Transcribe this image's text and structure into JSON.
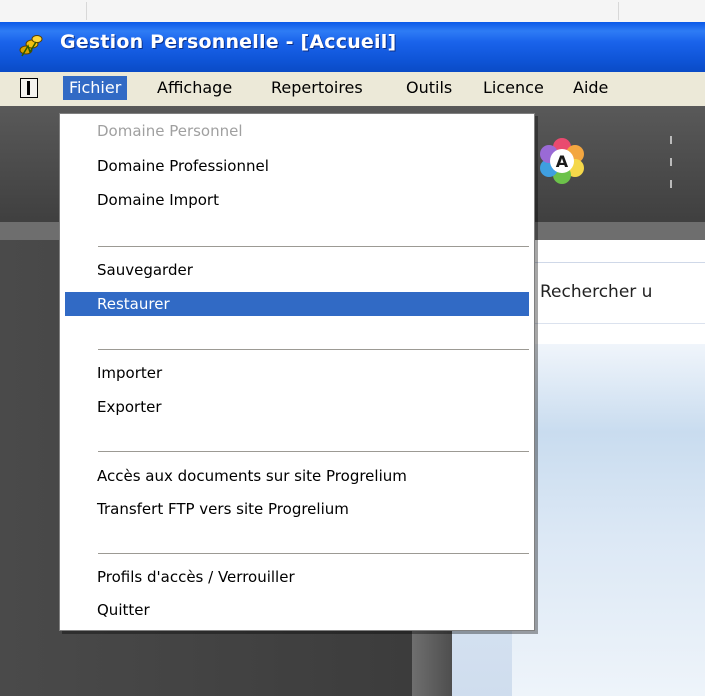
{
  "window": {
    "title": "Gestion Personnelle - [Accueil]"
  },
  "menubar": {
    "items": [
      "Fichier",
      "Affichage",
      "Repertoires",
      "Outils",
      "Licence",
      "Aide"
    ],
    "active": "Fichier"
  },
  "file_menu": {
    "items": [
      {
        "label": "Domaine Personnel",
        "state": "disabled"
      },
      {
        "label": "Domaine Professionnel",
        "state": "normal"
      },
      {
        "label": "Domaine Import",
        "state": "normal"
      },
      {
        "label": "Sauvegarder",
        "state": "normal"
      },
      {
        "label": "Restaurer",
        "state": "selected"
      },
      {
        "label": "Importer",
        "state": "normal"
      },
      {
        "label": "Exporter",
        "state": "normal"
      },
      {
        "label": "Accès aux documents sur site Progrelium",
        "state": "normal"
      },
      {
        "label": "Transfert FTP vers site Progrelium",
        "state": "normal"
      },
      {
        "label": "Profils d'accès / Verrouiller",
        "state": "normal"
      },
      {
        "label": "Quitter",
        "state": "normal"
      }
    ]
  },
  "search": {
    "label": "Rechercher u"
  },
  "icons": {
    "app": "coins-icon",
    "system_menu": "system-menu-icon",
    "toolbar_logo": "flower-a-logo-icon"
  },
  "colors": {
    "titlebar": "#0a59e8",
    "menu_highlight": "#316ac5",
    "menubar_bg": "#ece9d8"
  }
}
